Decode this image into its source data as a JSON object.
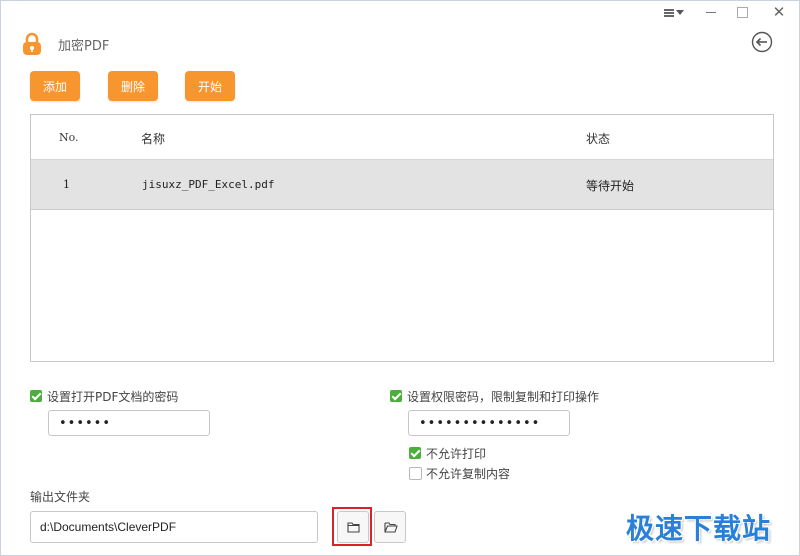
{
  "window": {
    "menu_icon": "menu-list-icon",
    "minimize_icon": "minimize-icon",
    "maximize_icon": "maximize-icon",
    "close_icon": "close-icon",
    "close_glyph": "✕"
  },
  "header": {
    "title": "加密PDF",
    "logo_icon": "lock-icon",
    "back_icon": "back-arrow-icon",
    "accent_color": "#f7962e"
  },
  "toolbar": {
    "add_label": "添加",
    "delete_label": "删除",
    "start_label": "开始"
  },
  "table": {
    "columns": [
      "No.",
      "名称",
      "状态"
    ],
    "rows": [
      {
        "no": "1",
        "name": "jisuxz_PDF_Excel.pdf",
        "status": "等待开始"
      }
    ]
  },
  "options": {
    "open_password": {
      "checked": true,
      "label": "设置打开PDF文档的密码",
      "value": "••••••"
    },
    "permission_password": {
      "checked": true,
      "label": "设置权限密码，限制复制和打印操作",
      "value": "••••••••••••••"
    },
    "no_print": {
      "checked": true,
      "label": "不允许打印"
    },
    "no_copy": {
      "checked": false,
      "label": "不允许复制内容"
    }
  },
  "output": {
    "label": "输出文件夹",
    "path": "d:\\Documents\\CleverPDF",
    "browse_icon": "folder-icon",
    "open_icon": "folder-open-icon"
  },
  "watermark": {
    "text": "极速下载站",
    "color": "#2a7fd6"
  }
}
